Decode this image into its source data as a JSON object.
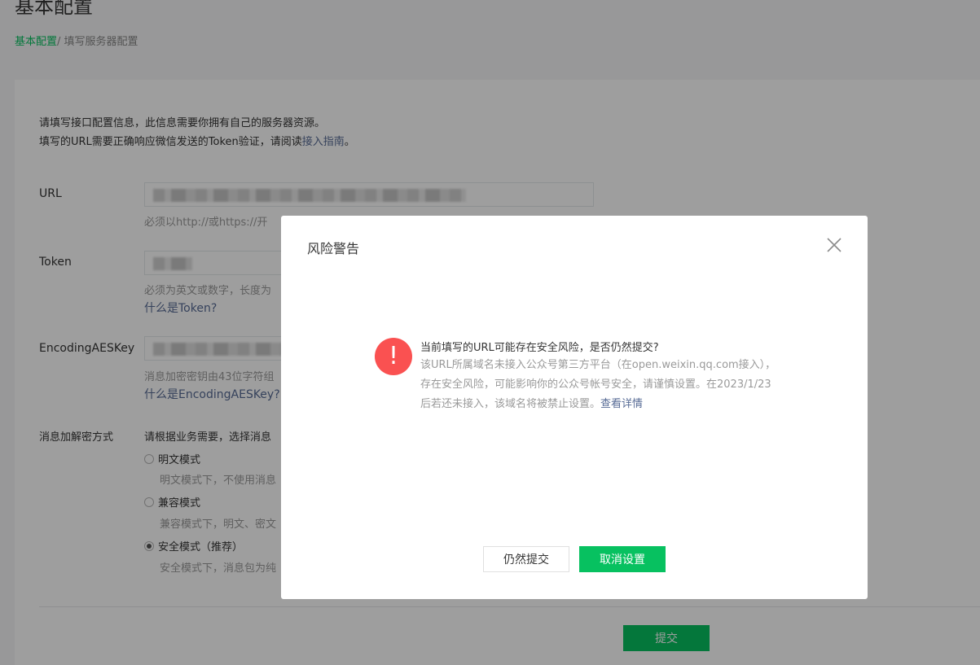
{
  "header": {
    "title": "基本配置",
    "breadcrumb_root": "基本配置",
    "breadcrumb_sep": "/ ",
    "breadcrumb_current": "填写服务器配置"
  },
  "intro": {
    "line1": "请填写接口配置信息，此信息需要你拥有自己的服务器资源。",
    "line2_prefix": "填写的URL需要正确响应微信发送的Token验证，请阅读",
    "line2_link": "接入指南",
    "line2_suffix": "。"
  },
  "form": {
    "url_label": "URL",
    "url_hint": "必须以http://或https://开",
    "token_label": "Token",
    "token_hint": "必须为英文或数字，长度为",
    "token_help": "什么是Token?",
    "aes_label": "EncodingAESKey",
    "aes_hint": "消息加密密钥由43位字符组",
    "aes_help": "什么是EncodingAESKey?",
    "mode_label": "消息加解密方式",
    "mode_hint": "请根据业务需要，选择消息",
    "modes": [
      {
        "label": "明文模式",
        "desc": "明文模式下，不使用消息",
        "checked": false
      },
      {
        "label": "兼容模式",
        "desc": "兼容模式下，明文、密文",
        "checked": false
      },
      {
        "label": "安全模式（推荐）",
        "desc": "安全模式下，消息包为纯",
        "checked": true
      }
    ],
    "submit_label": "提交"
  },
  "dialog": {
    "title": "风险警告",
    "icon": "!",
    "warn_title": "当前填写的URL可能存在安全风险，是否仍然提交?",
    "warn_body": "该URL所属域名未接入公众号第三方平台（在open.weixin.qq.com接入），存在安全风险，可能影响你的公众号帐号安全，请谨慎设置。在2023/1/23后若还未接入，该域名将被禁止设置。",
    "detail_link": "查看详情",
    "btn_submit_anyway": "仍然提交",
    "btn_cancel": "取消设置"
  },
  "colors": {
    "primary": "#07c160",
    "link": "#576b95",
    "danger": "#fa5151"
  }
}
